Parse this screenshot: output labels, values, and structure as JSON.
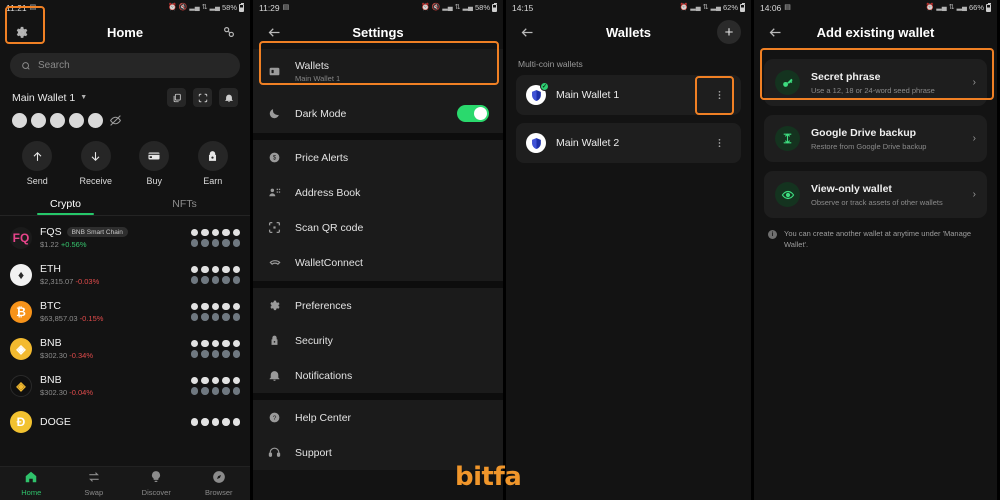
{
  "accent": {
    "highlight": "#f08024",
    "green": "#2ecc71",
    "up": "#35c46d",
    "down": "#e04b4b",
    "watermark": "#f0962b"
  },
  "watermark": {
    "text": "bitfa"
  },
  "panel_home": {
    "status": {
      "time": "11:21",
      "battery": "58%"
    },
    "appbar": {
      "title": "Home",
      "gear_icon": "gear-icon",
      "link_icon": "wallet-connect-icon"
    },
    "search": {
      "placeholder": "Search",
      "icon": "search-icon"
    },
    "wallet_selector": {
      "name": "Main Wallet 1",
      "caret": "▼"
    },
    "top_actions": [
      {
        "name": "copy-button",
        "icon": "copy-icon"
      },
      {
        "name": "scan-button",
        "icon": "scan-icon"
      },
      {
        "name": "notifications-button",
        "icon": "bell-icon"
      }
    ],
    "balance": {
      "hidden": true,
      "dots": 5,
      "eye_icon": "eye-off-icon"
    },
    "actions": [
      {
        "label": "Send",
        "icon": "arrow-up-icon"
      },
      {
        "label": "Receive",
        "icon": "arrow-down-icon"
      },
      {
        "label": "Buy",
        "icon": "card-icon"
      },
      {
        "label": "Earn",
        "icon": "earn-icon"
      }
    ],
    "tabs": [
      {
        "label": "Crypto",
        "active": true
      },
      {
        "label": "NFTs",
        "active": false
      }
    ],
    "coins": [
      {
        "symbol": "FQS",
        "chip": "BNB Smart Chain",
        "price": "$1.22",
        "change": "+0.56%",
        "dir": "up",
        "color": "#e8448b",
        "glyph": "FQ"
      },
      {
        "symbol": "ETH",
        "chip": "",
        "price": "$2,315.07",
        "change": "-0.03%",
        "dir": "down",
        "color": "#f3f3f3",
        "glyph": "♦"
      },
      {
        "symbol": "BTC",
        "chip": "",
        "price": "$63,857.03",
        "change": "-0.15%",
        "dir": "down",
        "color": "#f7931a",
        "glyph": "₿"
      },
      {
        "symbol": "BNB",
        "chip": "",
        "price": "$302.30",
        "change": "-0.34%",
        "dir": "down",
        "color": "#f3ba2f",
        "glyph": "◈"
      },
      {
        "symbol": "BNB",
        "chip": "",
        "price": "$302.30",
        "change": "-0.04%",
        "dir": "down",
        "color": "#1a1a1a",
        "glyph": "◈"
      },
      {
        "symbol": "DOGE",
        "chip": "",
        "price": "",
        "change": "",
        "dir": "up",
        "color": "#f2c230",
        "glyph": "Ð"
      }
    ],
    "bottom_nav": [
      {
        "label": "Home",
        "icon": "home-icon",
        "active": true
      },
      {
        "label": "Swap",
        "icon": "swap-icon",
        "active": false
      },
      {
        "label": "Discover",
        "icon": "bulb-icon",
        "active": false
      },
      {
        "label": "Browser",
        "icon": "compass-icon",
        "active": false
      }
    ]
  },
  "panel_settings": {
    "status": {
      "time": "11:29",
      "battery": "58%"
    },
    "appbar": {
      "title": "Settings",
      "back_icon": "back-arrow-icon"
    },
    "wallets_row": {
      "title": "Wallets",
      "subtitle": "Main Wallet 1",
      "icon": "wallet-icon",
      "highlighted": true
    },
    "dark_mode": {
      "title": "Dark Mode",
      "icon": "moon-icon",
      "toggle_on": true
    },
    "group_one": [
      {
        "label": "Price Alerts",
        "icon": "price-alert-icon"
      },
      {
        "label": "Address Book",
        "icon": "address-book-icon"
      },
      {
        "label": "Scan QR code",
        "icon": "qr-icon"
      },
      {
        "label": "WalletConnect",
        "icon": "walletconnect-icon"
      }
    ],
    "group_two": [
      {
        "label": "Preferences",
        "icon": "gear-icon"
      },
      {
        "label": "Security",
        "icon": "lock-icon"
      },
      {
        "label": "Notifications",
        "icon": "bell-icon"
      }
    ],
    "group_three": [
      {
        "label": "Help Center",
        "icon": "question-icon"
      },
      {
        "label": "Support",
        "icon": "headset-icon"
      }
    ]
  },
  "panel_wallets": {
    "status": {
      "time": "14:15",
      "battery": "62%"
    },
    "appbar": {
      "title": "Wallets",
      "back_icon": "back-arrow-icon",
      "add_icon": "plus-icon"
    },
    "section_label": "Multi-coin wallets",
    "wallets": [
      {
        "name": "Main Wallet 1",
        "selected": true,
        "menu_icon": "kebab-menu-icon",
        "highlighted": true
      },
      {
        "name": "Main Wallet 2",
        "selected": false,
        "menu_icon": "kebab-menu-icon",
        "highlighted": false
      }
    ]
  },
  "panel_add_wallet": {
    "status": {
      "time": "14:06",
      "battery": "66%"
    },
    "appbar": {
      "title": "Add existing wallet",
      "back_icon": "back-arrow-icon"
    },
    "options": [
      {
        "title": "Secret phrase",
        "subtitle": "Use a 12, 18 or 24-word seed phrase",
        "icon": "key-icon",
        "highlighted": true
      },
      {
        "title": "Google Drive backup",
        "subtitle": "Restore from Google Drive backup",
        "icon": "drive-icon",
        "highlighted": false
      },
      {
        "title": "View-only wallet",
        "subtitle": "Observe or track assets of other wallets",
        "icon": "eye-icon",
        "highlighted": false
      }
    ],
    "note": "You can create another wallet at anytime under 'Manage Wallet'.",
    "note_icon": "info-icon"
  }
}
